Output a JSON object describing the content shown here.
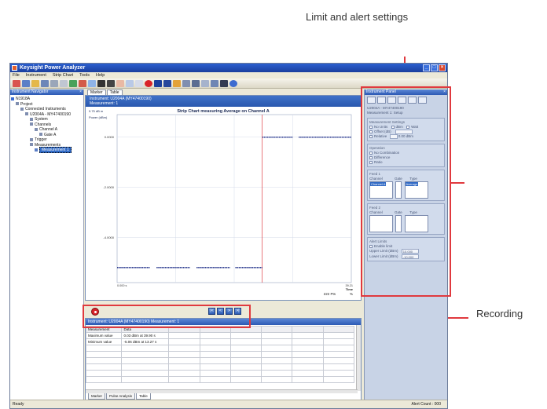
{
  "callouts": {
    "limit_alert": "Limit and alert settings",
    "recording": "Recording"
  },
  "colors": {
    "callout_red": "#e0393e",
    "title_blue": "#2b5fd0",
    "trace": "#2b3a8f",
    "marker_red": "#d8232a"
  },
  "app": {
    "title": "Keysight Power Analyzer",
    "menu": [
      "File",
      "Instrument",
      "Strip Chart",
      "Tools",
      "Help"
    ]
  },
  "navigator": {
    "title": "Instrument Navigator",
    "tree": [
      {
        "label": "N1918A",
        "indent": 0
      },
      {
        "label": "Project",
        "indent": 1
      },
      {
        "label": "Connected Instruments",
        "indent": 2
      },
      {
        "label": "U2004A - MY47400190",
        "indent": 3
      },
      {
        "label": "System",
        "indent": 4
      },
      {
        "label": "Channels",
        "indent": 4
      },
      {
        "label": "Channel A",
        "indent": 5
      },
      {
        "label": "Gate A",
        "indent": 6
      },
      {
        "label": "Trigger",
        "indent": 4
      },
      {
        "label": "Measurements",
        "indent": 4
      },
      {
        "label": "Measurement 1",
        "indent": 5,
        "selected": true
      }
    ]
  },
  "tabs": [
    "Marker",
    "Table"
  ],
  "chart": {
    "banner_line1": "Instrument: U2004A (MY47400190)",
    "banner_line2": "Measurement: 1",
    "title": "Strip Chart measuring Average on Channel A",
    "top_value": "9.75 dB m",
    "ylabel": "Power (dBm)",
    "yticks": [
      "0.0000",
      "-2.0000",
      "-4.0000"
    ],
    "xstart": "0.000 s",
    "xend_value": "39.21",
    "xend_unit": "Time",
    "footer_value": "222 Pts",
    "footer_unit": "%"
  },
  "chart_data": {
    "type": "line",
    "title": "Strip Chart measuring Average on Channel A",
    "ylabel": "Power (dBm)",
    "xlabel": "Time",
    "ylim": [
      -5.8,
      0.9
    ],
    "xlim": [
      0,
      39.21
    ],
    "series": [
      {
        "x": [
          0.0,
          5.5,
          6.6,
          12.2,
          13.3,
          18.9,
          19.8,
          24.3,
          24.3,
          29.4,
          30.4,
          39.21
        ],
        "values": [
          -5.2,
          -5.2,
          -5.2,
          -5.2,
          -5.2,
          -5.2,
          -5.2,
          -5.2,
          0.0,
          0.0,
          0.0,
          0.0
        ]
      }
    ],
    "grid": true,
    "legend": "none"
  },
  "playback": [
    "|<",
    "<",
    ">",
    ">|"
  ],
  "table": {
    "header": "Instrument: U2004A (MY47400190) Measurement: 1",
    "columns": [
      "Measurement",
      "Data",
      "",
      "",
      "",
      "",
      "",
      ""
    ],
    "rows": [
      [
        "Maximum value",
        "0.03 dBm at 39.90 s",
        "",
        "",
        "",
        "",
        "",
        ""
      ],
      [
        "Minimum value",
        "-5.06 dBm at 13.27 s",
        "",
        "",
        "",
        "",
        "",
        ""
      ],
      [
        "",
        "",
        "",
        "",
        "",
        "",
        "",
        ""
      ],
      [
        "",
        "",
        "",
        "",
        "",
        "",
        "",
        ""
      ],
      [
        "",
        "",
        "",
        "",
        "",
        "",
        "",
        ""
      ],
      [
        "",
        "",
        "",
        "",
        "",
        "",
        "",
        ""
      ],
      [
        "",
        "",
        "",
        "",
        "",
        "",
        "",
        ""
      ],
      [
        "",
        "",
        "",
        "",
        "",
        "",
        "",
        ""
      ]
    ],
    "bottom_tabs": [
      "Marker",
      "Pulse Analysis",
      "Table"
    ],
    "active_bottom_tab": "Table"
  },
  "instrument_panel": {
    "title": "Instrument Panel",
    "device": "U2004A - MY47400190",
    "setup": "Measurement 1: Setup",
    "measurement_settings": "Measurement Settings",
    "no_units": "No Units",
    "dbm": "dBm",
    "watt": "Watt",
    "offset": "Offset (dB)",
    "relative": "Relative",
    "relative_value": "0.00 dBm",
    "operation": "Operation",
    "op_none": "No Combination",
    "op_diff": "Difference",
    "op_ratio": "Ratio",
    "feed1": "Feed 1",
    "feed2": "Feed 2",
    "channel": "Channel",
    "gate": "Gate",
    "type": "Type",
    "feed1_channel": "Channel A",
    "feed1_type": "Average",
    "alert": "Alert Limits",
    "enable": "Enable limit",
    "upper": "Upper Limit (dBm)",
    "lower": "Lower Limit (dBm)",
    "upper_value": "10.000",
    "lower_value": "-10.000"
  },
  "status": {
    "left": "Ready",
    "right": "Alert Count : 000"
  }
}
